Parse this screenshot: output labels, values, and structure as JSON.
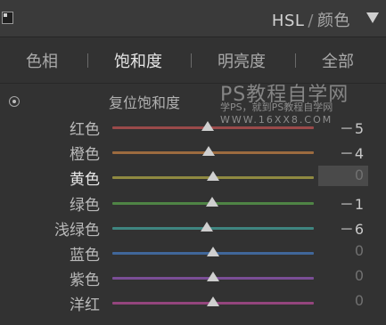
{
  "header": {
    "title_main": "HSL",
    "title_separator": "/",
    "title_sub": "颜色"
  },
  "tabs": [
    {
      "label": "色相",
      "active": false
    },
    {
      "label": "饱和度",
      "active": true
    },
    {
      "label": "明亮度",
      "active": false
    },
    {
      "label": "全部",
      "active": false
    }
  ],
  "panel": {
    "reset_label": "复位饱和度"
  },
  "watermark": {
    "title": "PS教程自学网",
    "subtitle": "学PS，就到PS教程自学网",
    "url": "WWW.16XX8.COM"
  },
  "sliders": [
    {
      "label": "红色",
      "value": "－5",
      "value_num": -5,
      "track_color": "#9a4a4a",
      "active": false
    },
    {
      "label": "橙色",
      "value": "－4",
      "value_num": -4,
      "track_color": "#9c6b3f",
      "active": false
    },
    {
      "label": "黄色",
      "value": "0",
      "value_num": 0,
      "track_color": "#8f8a41",
      "active": true
    },
    {
      "label": "绿色",
      "value": "－1",
      "value_num": -1,
      "track_color": "#4f8445",
      "active": false
    },
    {
      "label": "浅绿色",
      "value": "－6",
      "value_num": -6,
      "track_color": "#3f8580",
      "active": false
    },
    {
      "label": "蓝色",
      "value": "0",
      "value_num": 0,
      "track_color": "#40679a",
      "active": false
    },
    {
      "label": "紫色",
      "value": "0",
      "value_num": 0,
      "track_color": "#7a4e96",
      "active": false
    },
    {
      "label": "洋红",
      "value": "0",
      "value_num": 0,
      "track_color": "#94457d",
      "active": false
    }
  ],
  "slider_range": [
    -100,
    100
  ],
  "colors": {
    "panel_bg": "#323232",
    "header_bg": "#3a3a3a",
    "active_value_bg": "#4a4a4a",
    "thumb": "#cfcfcf"
  }
}
